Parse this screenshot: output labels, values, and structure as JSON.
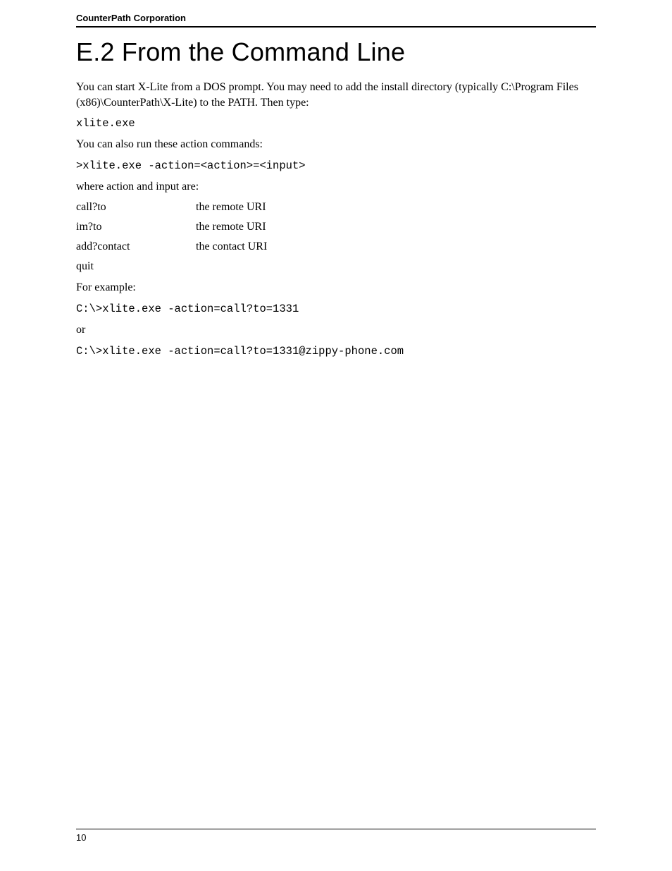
{
  "header": {
    "company": "CounterPath Corporation"
  },
  "title": "E.2 From the Command Line",
  "intro": "You can start X-Lite from a DOS prompt. You may need to add the install directory (typically C:\\Program Files (x86)\\CounterPath\\X-Lite) to the PATH. Then type:",
  "cmd1": "xlite.exe",
  "also_run": "You can also run these action commands:",
  "cmd2": ">xlite.exe -action=<action>=<input>",
  "where_text": "where action and input are:",
  "actions": [
    {
      "action": "call?to",
      "input": "the remote URI"
    },
    {
      "action": "im?to",
      "input": "the remote URI"
    },
    {
      "action": "add?contact",
      "input": "the contact URI"
    },
    {
      "action": "quit",
      "input": ""
    }
  ],
  "for_example": "For example:",
  "example1": "C:\\>xlite.exe -action=call?to=1331",
  "or_text": "or",
  "example2": "C:\\>xlite.exe -action=call?to=1331@zippy-phone.com",
  "footer": {
    "page_number": "10"
  }
}
